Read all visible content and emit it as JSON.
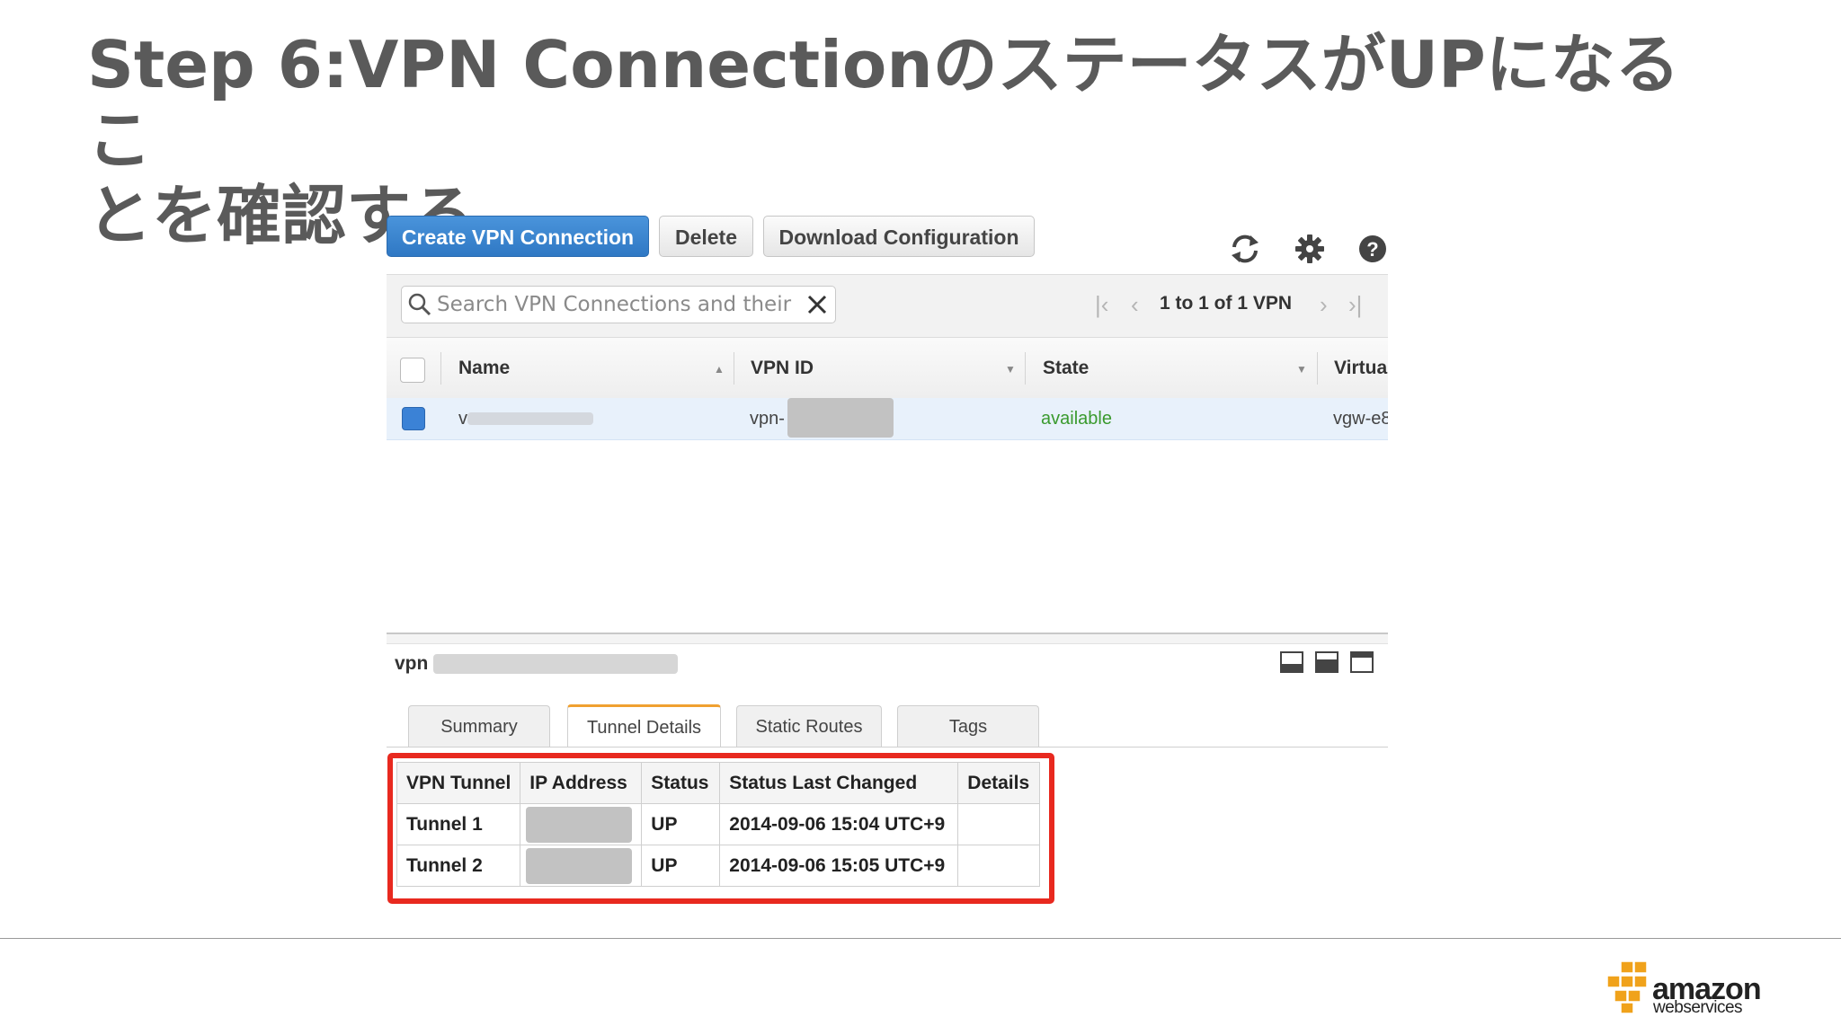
{
  "slide": {
    "title_line1": "Step 6:VPN ConnectionのステータスがUPになるこ",
    "title_line2": "とを確認する"
  },
  "toolbar": {
    "create_label": "Create VPN Connection",
    "delete_label": "Delete",
    "download_label": "Download Configuration",
    "icons": [
      "refresh-icon",
      "gear-icon",
      "help-icon"
    ]
  },
  "search": {
    "placeholder": "Search VPN Connections and their"
  },
  "pager": {
    "text": "1 to 1 of 1 VPN"
  },
  "table": {
    "columns": [
      "Name",
      "VPN ID",
      "State",
      "Virtua"
    ],
    "rows": [
      {
        "name": "v",
        "vpn_id": "vpn-",
        "state": "available",
        "virtual": "vgw-e8"
      }
    ]
  },
  "detail": {
    "vpn_label": "vpn",
    "tabs": [
      "Summary",
      "Tunnel Details",
      "Static Routes",
      "Tags"
    ],
    "active_tab": "Tunnel Details",
    "tunnels": {
      "headers": [
        "VPN Tunnel",
        "IP Address",
        "Status",
        "Status Last Changed",
        "Details"
      ],
      "rows": [
        {
          "tunnel": "Tunnel 1",
          "ip": "",
          "status": "UP",
          "changed": "2014-09-06 15:04 UTC+9",
          "details": ""
        },
        {
          "tunnel": "Tunnel 2",
          "ip": "",
          "status": "UP",
          "changed": "2014-09-06 15:05 UTC+9",
          "details": ""
        }
      ]
    }
  },
  "logo": {
    "word1": "amazon",
    "word2": "webservices"
  },
  "colors": {
    "primary_button": "#2f78c4",
    "available": "#3a9a2e",
    "highlight_box": "#e8291f",
    "title": "#5a5a5a"
  }
}
